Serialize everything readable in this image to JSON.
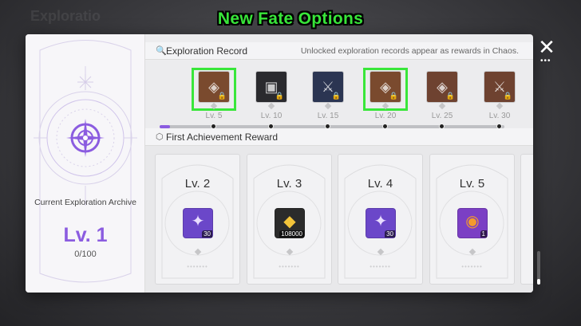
{
  "background": {
    "ghost_text": "Exploratio"
  },
  "overlay_title": "New Fate Options",
  "archive": {
    "label": "Current Exploration Archive",
    "level": "Lv. 1",
    "progress": "0/100"
  },
  "exploration_record": {
    "title": "Exploration Record",
    "note": "Unlocked exploration records appear as rewards in Chaos.",
    "progress_fraction": 0.03,
    "items": [
      {
        "level": "Lv. 5",
        "icon": "fate-card-brown",
        "color": "#7a4a2e",
        "highlighted": true
      },
      {
        "level": "Lv. 10",
        "icon": "fate-card-black",
        "color": "#2a2a2e",
        "highlighted": false
      },
      {
        "level": "Lv. 15",
        "icon": "crossed-swords-navy",
        "color": "#2b3552",
        "highlighted": false
      },
      {
        "level": "Lv. 20",
        "icon": "fate-card-brown",
        "color": "#7a4a2e",
        "highlighted": true
      },
      {
        "level": "Lv. 25",
        "icon": "fate-card-brown",
        "color": "#6e4230",
        "highlighted": false
      },
      {
        "level": "Lv. 30",
        "icon": "crossed-swords-brown",
        "color": "#6e4230",
        "highlighted": false
      }
    ]
  },
  "first_achievement": {
    "title": "First Achievement Reward",
    "cards": [
      {
        "level": "Lv. 2",
        "item_icon": "purple-star-crystal",
        "item_color": "#6b47c9",
        "quantity": "30"
      },
      {
        "level": "Lv. 3",
        "item_icon": "gold-credit",
        "item_color": "#2b2b2b",
        "quantity": "108000"
      },
      {
        "level": "Lv. 4",
        "item_icon": "purple-star-crystal",
        "item_color": "#6b47c9",
        "quantity": "30"
      },
      {
        "level": "Lv. 5",
        "item_icon": "orange-orb-relic",
        "item_color": "#7b3fc4",
        "quantity": "1"
      }
    ]
  }
}
